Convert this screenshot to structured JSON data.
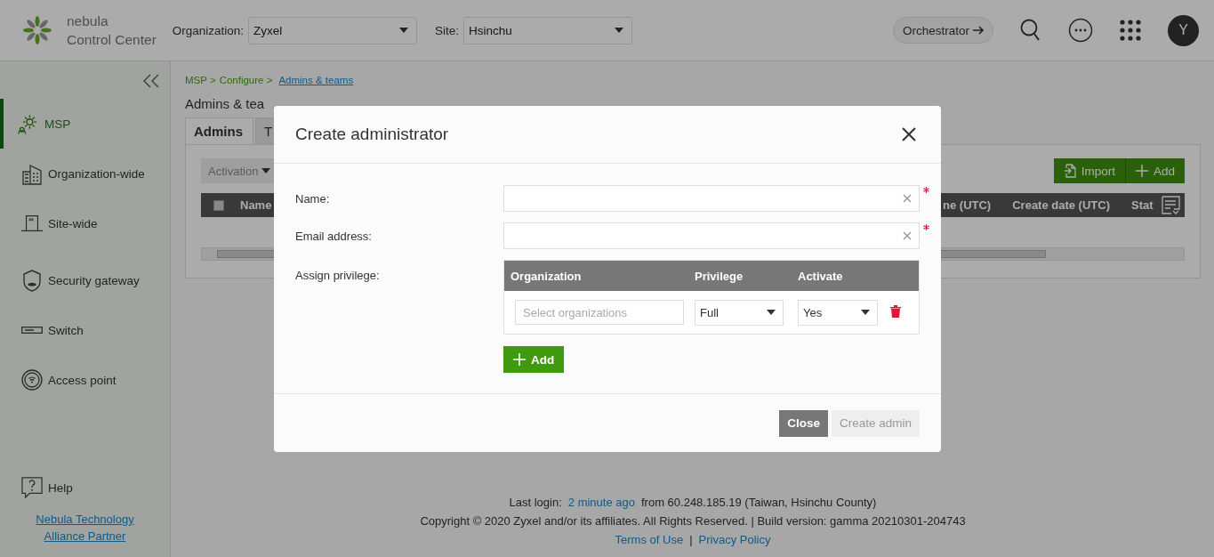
{
  "header": {
    "logo_lines": [
      "nebula",
      "Control Center"
    ],
    "selectors": [
      {
        "label": "Organization:",
        "value": "Zyxel"
      },
      {
        "label": "Site:",
        "value": "Hsinchu"
      }
    ],
    "orchestrator_button": "Orchestrator",
    "avatar": "Y"
  },
  "sidebar": {
    "items": [
      {
        "label": "MSP",
        "selected": true
      },
      {
        "label": "Organization-wide",
        "selected": false
      },
      {
        "label": "Site-wide",
        "selected": false
      },
      {
        "label": "Security gateway",
        "selected": false
      },
      {
        "label": "Switch",
        "selected": false
      },
      {
        "label": "Access point",
        "selected": false
      }
    ],
    "help": "Help",
    "partner_link": "Nebula Technology Alliance Partner"
  },
  "main": {
    "breadcrumb": [
      {
        "label": "MSP >",
        "kind": "text"
      },
      {
        "label": "Configure >",
        "kind": "text"
      },
      {
        "label": "Admins & teams",
        "kind": "link"
      }
    ],
    "page_title": "Admins & tea",
    "tabs": [
      {
        "label": "Admins",
        "selected": true
      },
      {
        "label": "T",
        "selected": false
      }
    ],
    "activation_button": {
      "label": "Activation",
      "disabled": true
    },
    "import_button": "Import",
    "add_button": "Add",
    "table": {
      "select_all_checked": false,
      "left_columns": [
        "Name"
      ],
      "right_columns": [
        "ne (UTC)",
        "Create date (UTC)",
        "Stat"
      ]
    }
  },
  "footer": {
    "last_login": {
      "prefix": "Last login:",
      "link": "2 minute ago",
      "suffix": "from 60.248.185.19 (Taiwan, Hsinchu County)"
    },
    "copyright": "Copyright © 2020 Zyxel and/or its affiliates. All Rights Reserved. | Build version: gamma 20210301-204743",
    "links": [
      "Terms of Use",
      "Privacy Policy"
    ],
    "separator": "|"
  },
  "modal": {
    "title": "Create administrator",
    "fields": [
      {
        "label": "Name:",
        "required": true
      },
      {
        "label": "Email address:",
        "required": true
      }
    ],
    "privilege": {
      "label": "Assign privilege:",
      "columns": [
        "Organization",
        "Privilege",
        "Activate"
      ],
      "rows": [
        {
          "organization_placeholder": "Select organizations",
          "privilege": "Full",
          "activate": "Yes"
        }
      ],
      "add_button": "Add"
    },
    "buttons": [
      {
        "label": "Close",
        "disabled": false,
        "kind": "secondary"
      },
      {
        "label": "Create admin",
        "disabled": true,
        "kind": "primary"
      }
    ]
  }
}
